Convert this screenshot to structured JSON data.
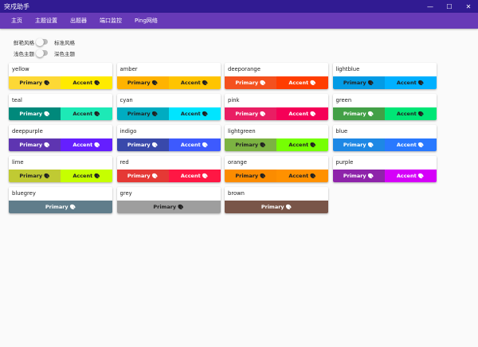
{
  "window": {
    "title": "突戍助手",
    "min": "—",
    "max": "☐",
    "close": "✕"
  },
  "nav": [
    "主页",
    "主题设置",
    "出题器",
    "端口监控",
    "Ping网络"
  ],
  "toggles": [
    {
      "label": "鲜艳风格",
      "label2": "标准风格"
    },
    {
      "label": "浅色主题",
      "label2": "深色主题"
    }
  ],
  "labels": {
    "primary": "Primary",
    "accent": "Accent",
    "palette_icon": "palette-icon"
  },
  "swatches": [
    {
      "name": "yellow",
      "primary": "#fdd835",
      "accent": "#ffea00",
      "primaryText": "#222",
      "accentText": "#222"
    },
    {
      "name": "amber",
      "primary": "#ffb300",
      "accent": "#ffc400",
      "primaryText": "#222",
      "accentText": "#222"
    },
    {
      "name": "deeporange",
      "primary": "#f4511e",
      "accent": "#ff3d00",
      "primaryText": "#fff",
      "accentText": "#fff"
    },
    {
      "name": "lightblue",
      "primary": "#039be5",
      "accent": "#00b0ff",
      "primaryText": "#222",
      "accentText": "#222"
    },
    {
      "name": "teal",
      "primary": "#00897b",
      "accent": "#1de9b6",
      "primaryText": "#fff",
      "accentText": "#222"
    },
    {
      "name": "cyan",
      "primary": "#00acc1",
      "accent": "#00e5ff",
      "primaryText": "#222",
      "accentText": "#222"
    },
    {
      "name": "pink",
      "primary": "#e91e63",
      "accent": "#f50057",
      "primaryText": "#fff",
      "accentText": "#fff"
    },
    {
      "name": "green",
      "primary": "#43a047",
      "accent": "#00e676",
      "primaryText": "#fff",
      "accentText": "#222"
    },
    {
      "name": "deeppurple",
      "primary": "#5e35b1",
      "accent": "#651fff",
      "primaryText": "#fff",
      "accentText": "#fff"
    },
    {
      "name": "indigo",
      "primary": "#3949ab",
      "accent": "#3d5afe",
      "primaryText": "#fff",
      "accentText": "#fff"
    },
    {
      "name": "lightgreen",
      "primary": "#7cb342",
      "accent": "#76ff03",
      "primaryText": "#222",
      "accentText": "#222"
    },
    {
      "name": "blue",
      "primary": "#1e88e5",
      "accent": "#2979ff",
      "primaryText": "#fff",
      "accentText": "#fff"
    },
    {
      "name": "lime",
      "primary": "#c0ca33",
      "accent": "#c6ff00",
      "primaryText": "#222",
      "accentText": "#222"
    },
    {
      "name": "red",
      "primary": "#e53935",
      "accent": "#ff1744",
      "primaryText": "#fff",
      "accentText": "#fff"
    },
    {
      "name": "orange",
      "primary": "#fb8c00",
      "accent": "#ff9100",
      "primaryText": "#222",
      "accentText": "#222"
    },
    {
      "name": "purple",
      "primary": "#8e24aa",
      "accent": "#d500f9",
      "primaryText": "#fff",
      "accentText": "#fff"
    },
    {
      "name": "bluegrey",
      "primary": "#607d8b",
      "accent": null,
      "primaryText": "#fff"
    },
    {
      "name": "grey",
      "primary": "#9e9e9e",
      "accent": null,
      "primaryText": "#222"
    },
    {
      "name": "brown",
      "primary": "#795548",
      "accent": null,
      "primaryText": "#fff"
    }
  ]
}
